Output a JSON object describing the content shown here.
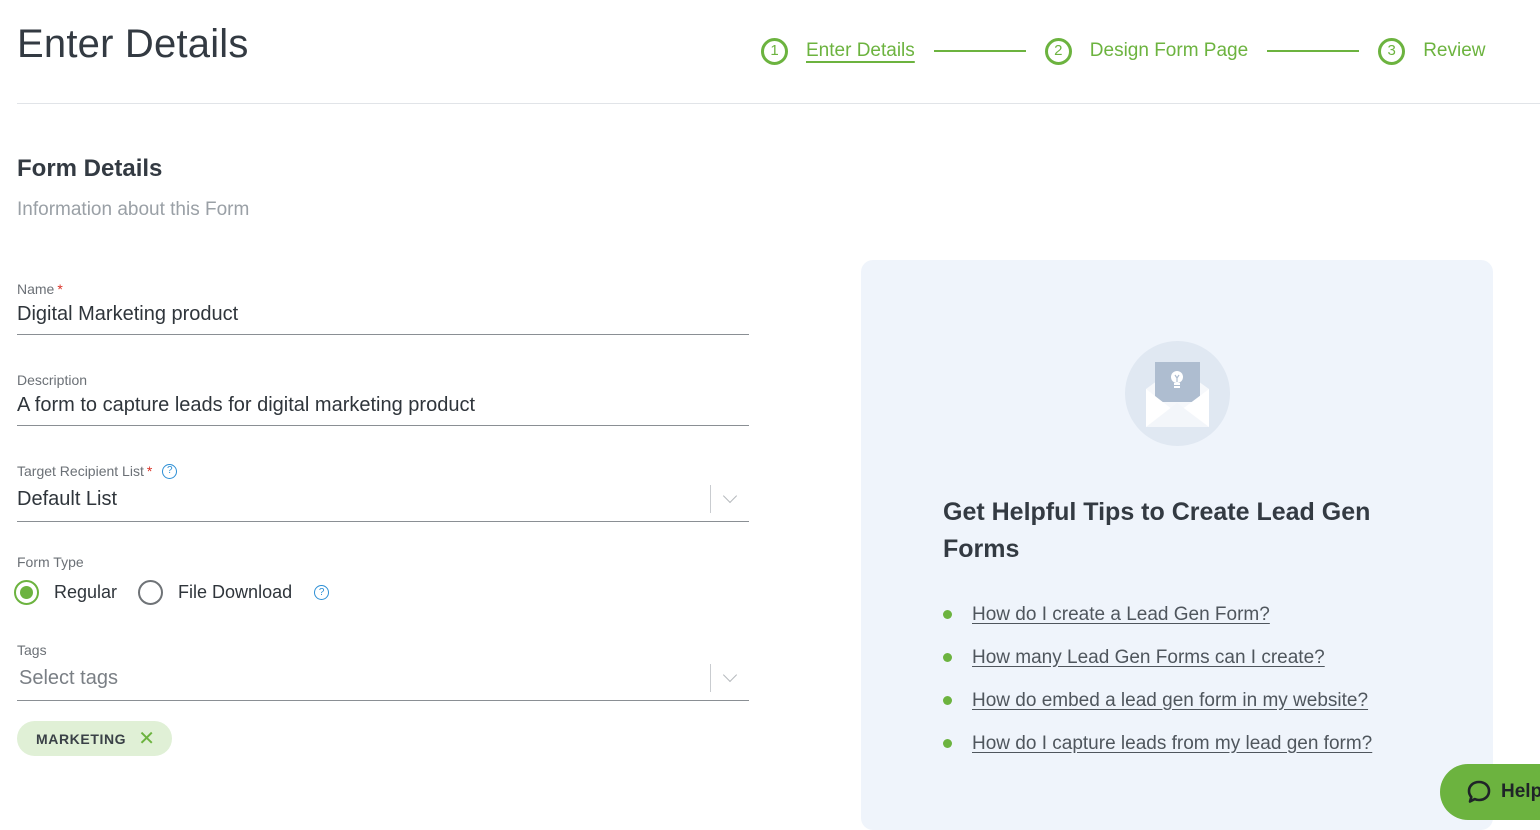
{
  "header": {
    "title": "Enter Details",
    "steps": [
      {
        "number": "1",
        "label": "Enter Details",
        "active": true
      },
      {
        "number": "2",
        "label": "Design Form Page",
        "active": false
      },
      {
        "number": "3",
        "label": "Review",
        "active": false
      }
    ]
  },
  "section": {
    "title": "Form Details",
    "subtitle": "Information about this Form"
  },
  "fields": {
    "name": {
      "label": "Name",
      "required_mark": "*",
      "value": "Digital Marketing product"
    },
    "description": {
      "label": "Description",
      "value": "A form to capture leads for digital marketing product"
    },
    "target_list": {
      "label": "Target Recipient List",
      "required_mark": "*",
      "help": "?",
      "value": "Default List"
    },
    "form_type": {
      "label": "Form Type",
      "options": [
        {
          "label": "Regular",
          "checked": true
        },
        {
          "label": "File Download",
          "checked": false
        }
      ],
      "help": "?"
    },
    "tags": {
      "label": "Tags",
      "placeholder": "Select tags",
      "chips": [
        {
          "label": "MARKETING",
          "remove": "✕"
        }
      ]
    }
  },
  "tips": {
    "title": "Get Helpful Tips to Create Lead Gen Forms",
    "links": [
      "How do I create a Lead Gen Form?",
      "How many Lead Gen Forms can I create?",
      "How do embed a lead gen form in my website?",
      "How do I capture leads from my lead gen form?"
    ]
  },
  "help_button": {
    "label": "Help"
  },
  "colors": {
    "accent": "#6cb33f",
    "panel_bg": "#eff4fb",
    "required": "#d93025",
    "info": "#2d8fd5"
  }
}
